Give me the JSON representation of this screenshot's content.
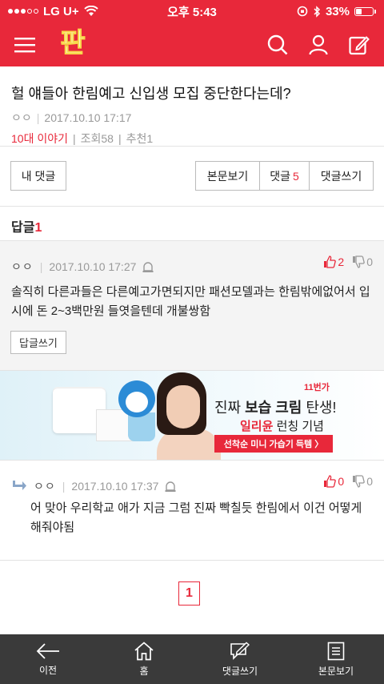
{
  "status_bar": {
    "carrier": "LG U+",
    "time": "오후 5:43",
    "battery_percent": "33%",
    "battery_level": 0.33
  },
  "header": {
    "logo_text": "판",
    "accent_color": "#e8283a"
  },
  "post": {
    "title": "헐 얘들아 한림예고 신입생 모집 중단한다는데?",
    "author": "ㅇㅇ",
    "date": "2017.10.10 17:17",
    "category": "10대 이야기",
    "views_label": "조회",
    "views": "58",
    "recommend_label": "추천",
    "recommend": "1"
  },
  "buttons": {
    "my_comments": "내 댓글",
    "view_post": "본문보기",
    "comments_label": "댓글",
    "comments_count": "5",
    "write_comment": "댓글쓰기"
  },
  "replies": {
    "heading": "답글",
    "count": "1"
  },
  "comments": [
    {
      "author": "ㅇㅇ",
      "date": "2017.10.10 17:27",
      "likes": "2",
      "dislikes": "0",
      "body": "솔직히 다른과들은 다른예고가면되지만 패션모델과는 한림밖에없어서 입시에 돈 2~3백만원 들엿을텐데 개불쌍함",
      "reply_button": "답글쓰기"
    },
    {
      "author": "ㅇㅇ",
      "date": "2017.10.10 17:37",
      "likes": "0",
      "dislikes": "0",
      "body": "어 맞아 우리학교 애가 지금 그럼 진짜 빡칠듯 한림에서 이건 어떻게 해줘야됨"
    }
  ],
  "ad": {
    "brand": "11번가",
    "line1_prefix": "진짜 ",
    "line1_bold": "보습 크림",
    "line1_suffix": " 탄생!",
    "line2_name": "일리윤",
    "line2_suffix": " 런칭 기념",
    "cta": "선착순 미니 가습기 득템 〉"
  },
  "pagination": {
    "current_page": "1"
  },
  "bottom_nav": [
    {
      "label": "이전",
      "icon": "back-arrow-icon"
    },
    {
      "label": "홈",
      "icon": "home-icon"
    },
    {
      "label": "댓글쓰기",
      "icon": "write-comment-icon"
    },
    {
      "label": "본문보기",
      "icon": "document-icon"
    }
  ]
}
